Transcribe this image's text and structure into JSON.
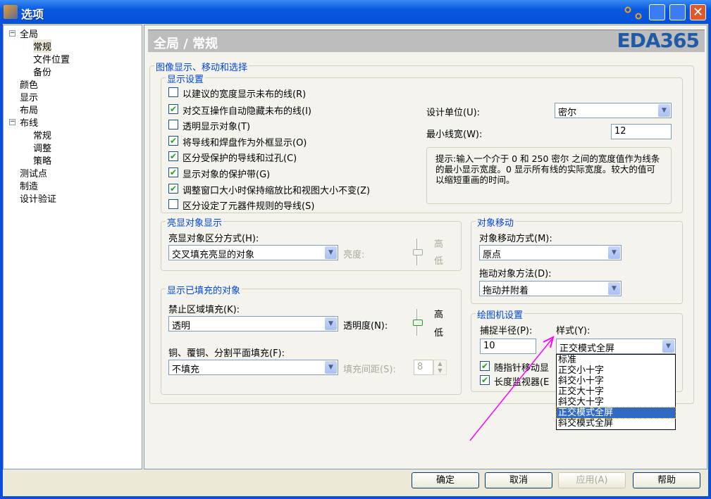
{
  "window": {
    "title": "选项"
  },
  "tree": {
    "items": [
      {
        "label": "全局",
        "expander": "−"
      },
      {
        "label": "常规",
        "selected": true
      },
      {
        "label": "文件位置"
      },
      {
        "label": "备份"
      },
      {
        "label": "颜色"
      },
      {
        "label": "显示"
      },
      {
        "label": "布局"
      },
      {
        "label": "布线",
        "expander": "−"
      },
      {
        "label": "常规"
      },
      {
        "label": "调整"
      },
      {
        "label": "策略"
      },
      {
        "label": "测试点"
      },
      {
        "label": "制造"
      },
      {
        "label": "设计验证"
      }
    ]
  },
  "header": {
    "title": "全局 / 常规",
    "logo": "EDA365"
  },
  "main_group": "图像显示、移动和选择",
  "display": {
    "title": "显示设置",
    "checkboxes": [
      {
        "label": "以建议的宽度显示未布的线(R)",
        "checked": false
      },
      {
        "label": "对交互操作自动隐藏未布的线(I)",
        "checked": true
      },
      {
        "label": "透明显示对象(T)",
        "checked": false
      },
      {
        "label": "将导线和焊盘作为外框显示(O)",
        "checked": true
      },
      {
        "label": "区分受保护的导线和过孔(C)",
        "checked": true
      },
      {
        "label": "显示对象的保护带(G)",
        "checked": true
      },
      {
        "label": "调整窗口大小时保持缩放比和视图大小不变(Z)",
        "checked": true
      },
      {
        "label": "区分设定了元器件规则的导线(S)",
        "checked": false
      }
    ],
    "unit_label": "设计单位(U):",
    "unit_value": "密尔",
    "minwidth_label": "最小线宽(W):",
    "minwidth_value": "12",
    "hint": "提示:输入一个介于 0 和 250 密尔 之间的宽度值作为线条的最小显示宽度。0 显示所有线的实际宽度。较大的值可以缩短重画的时间。"
  },
  "highlight": {
    "title": "亮显对象显示",
    "mode_label": "亮显对象区分方式(H):",
    "mode_value": "交叉填充亮显的对象",
    "brightness_label": "亮度:",
    "high": "高",
    "low": "低"
  },
  "filled": {
    "title": "显示已填充的对象",
    "keepout_label": "禁止区域填充(K):",
    "keepout_value": "透明",
    "transparency_label": "透明度(N):",
    "high": "高",
    "low": "低",
    "copper_label": "铜、覆铜、分割平面填充(F):",
    "copper_value": "不填充",
    "spacing_label": "填充间距(S):",
    "spacing_value": "8"
  },
  "move": {
    "title": "对象移动",
    "method_label": "对象移动方式(M):",
    "method_value": "原点",
    "drag_label": "拖动对象方法(D):",
    "drag_value": "拖动并附着"
  },
  "plotter": {
    "title": "绘图机设置",
    "snap_label": "捕捉半径(P):",
    "snap_value": "10",
    "style_label": "样式(Y):",
    "style_value": "正交模式全屏",
    "cb1": "随指针移动显",
    "cb2": "长度监视器(E",
    "options": [
      "标准",
      "正交小十字",
      "斜交小十字",
      "正交大十字",
      "斜交大十字",
      "正交模式全屏",
      "斜交模式全屏"
    ],
    "selected_index": 5
  },
  "buttons": {
    "ok": "确定",
    "cancel": "取消",
    "apply": "应用(A)",
    "help": "帮助"
  },
  "colors": {
    "title_bar": "#0858e0",
    "group_title": "#0046d5",
    "selection": "#316ac5",
    "annotation_arrow": "#ff00ff"
  }
}
